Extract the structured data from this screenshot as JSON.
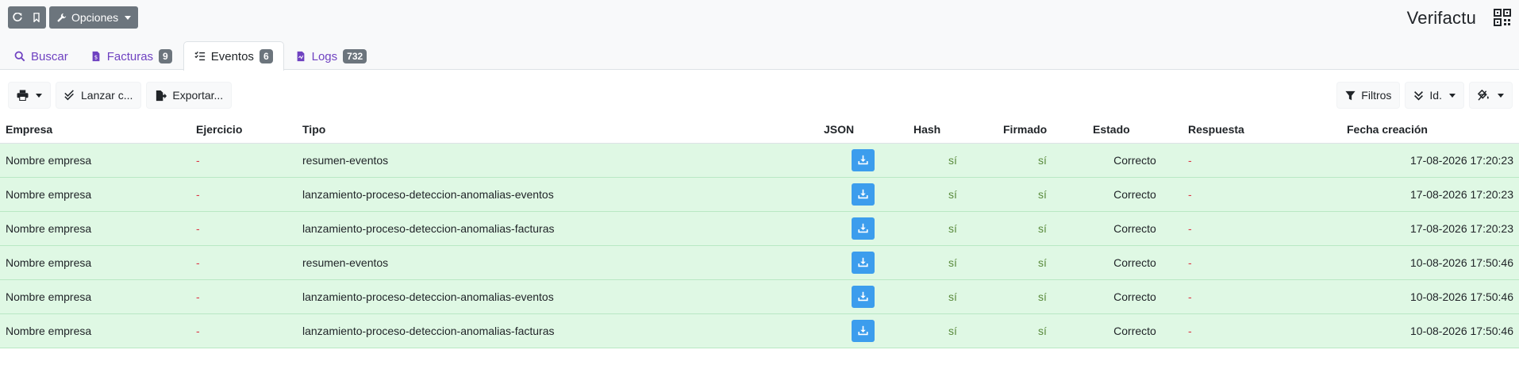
{
  "toolbar_top": {
    "refresh_icon": "refresh-icon",
    "bookmark_icon": "bookmark-icon",
    "options_label": "Opciones"
  },
  "app": {
    "title": "Verifactu"
  },
  "tabs": [
    {
      "label": "Buscar",
      "icon": "search-icon",
      "badge": null,
      "active": false
    },
    {
      "label": "Facturas",
      "icon": "invoice-icon",
      "badge": "9",
      "active": false
    },
    {
      "label": "Eventos",
      "icon": "list-check-icon",
      "badge": "6",
      "active": true
    },
    {
      "label": "Logs",
      "icon": "log-file-icon",
      "badge": "732",
      "active": false
    }
  ],
  "toolbar": {
    "print_icon": "print-icon",
    "launch_label": "Lanzar c...",
    "export_label": "Exportar...",
    "filters_label": "Filtros",
    "sort_label": "Id.",
    "paint_icon": "paint-bucket-icon"
  },
  "table": {
    "headers": {
      "empresa": "Empresa",
      "ejercicio": "Ejercicio",
      "tipo": "Tipo",
      "json": "JSON",
      "hash": "Hash",
      "firmado": "Firmado",
      "estado": "Estado",
      "respuesta": "Respuesta",
      "fecha": "Fecha creación"
    },
    "rows": [
      {
        "empresa": "Nombre empresa",
        "ejercicio": "-",
        "tipo": "resumen-eventos",
        "hash": "sí",
        "firmado": "sí",
        "estado": "Correcto",
        "respuesta": "-",
        "fecha": "17-08-2026 17:20:23"
      },
      {
        "empresa": "Nombre empresa",
        "ejercicio": "-",
        "tipo": "lanzamiento-proceso-deteccion-anomalias-eventos",
        "hash": "sí",
        "firmado": "sí",
        "estado": "Correcto",
        "respuesta": "-",
        "fecha": "17-08-2026 17:20:23"
      },
      {
        "empresa": "Nombre empresa",
        "ejercicio": "-",
        "tipo": "lanzamiento-proceso-deteccion-anomalias-facturas",
        "hash": "sí",
        "firmado": "sí",
        "estado": "Correcto",
        "respuesta": "-",
        "fecha": "17-08-2026 17:20:23"
      },
      {
        "empresa": "Nombre empresa",
        "ejercicio": "-",
        "tipo": "resumen-eventos",
        "hash": "sí",
        "firmado": "sí",
        "estado": "Correcto",
        "respuesta": "-",
        "fecha": "10-08-2026 17:50:46"
      },
      {
        "empresa": "Nombre empresa",
        "ejercicio": "-",
        "tipo": "lanzamiento-proceso-deteccion-anomalias-eventos",
        "hash": "sí",
        "firmado": "sí",
        "estado": "Correcto",
        "respuesta": "-",
        "fecha": "10-08-2026 17:50:46"
      },
      {
        "empresa": "Nombre empresa",
        "ejercicio": "-",
        "tipo": "lanzamiento-proceso-deteccion-anomalias-facturas",
        "hash": "sí",
        "firmado": "sí",
        "estado": "Correcto",
        "respuesta": "-",
        "fecha": "10-08-2026 17:50:46"
      }
    ]
  },
  "colors": {
    "accent": "#6f42c1",
    "row_success": "#dff8e4",
    "json_button": "#3c9ded",
    "badge": "#6c757d"
  }
}
